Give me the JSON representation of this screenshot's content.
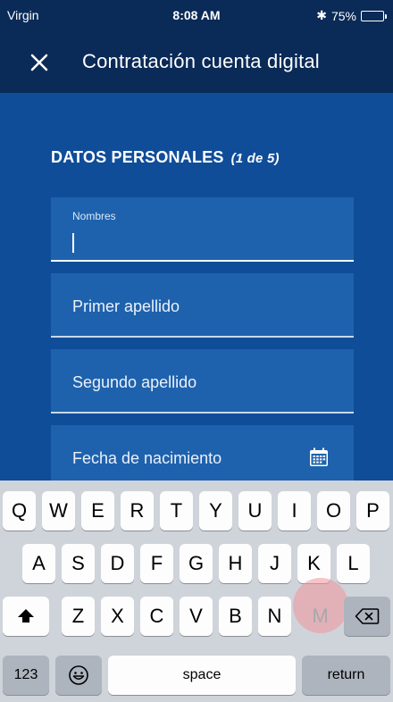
{
  "status_bar": {
    "carrier": "Virgin",
    "time": "8:08 AM",
    "bluetooth": "✱",
    "battery": "75%",
    "battery_level": 0.75
  },
  "nav": {
    "close_icon": "close-icon",
    "title": "Contratación cuenta digital"
  },
  "form": {
    "section_title": "DATOS PERSONALES",
    "step": "(1 de 5)",
    "fields": [
      {
        "label": "Nombres",
        "value": ""
      },
      {
        "placeholder": "Primer apellido"
      },
      {
        "placeholder": "Segundo apellido"
      },
      {
        "placeholder": "Fecha de nacimiento",
        "icon": "calendar-icon"
      }
    ]
  },
  "keyboard": {
    "row1": [
      "Q",
      "W",
      "E",
      "R",
      "T",
      "Y",
      "U",
      "I",
      "O",
      "P"
    ],
    "row2": [
      "A",
      "S",
      "D",
      "F",
      "G",
      "H",
      "J",
      "K",
      "L"
    ],
    "row3": [
      "Z",
      "X",
      "C",
      "V",
      "B",
      "N",
      "M"
    ],
    "shift_icon": "shift-icon",
    "backspace_icon": "backspace-icon",
    "numbers_label": "123",
    "emoji_icon": "emoji-icon",
    "space_label": "space",
    "return_label": "return",
    "pressed_key": "M"
  },
  "colors": {
    "nav_bg": "#0a2a57",
    "content_bg": "#0f4d99",
    "field_bg": "#1e62ad",
    "keyboard_bg": "#cfd3da",
    "pressed_highlight": "#efa2a9"
  }
}
